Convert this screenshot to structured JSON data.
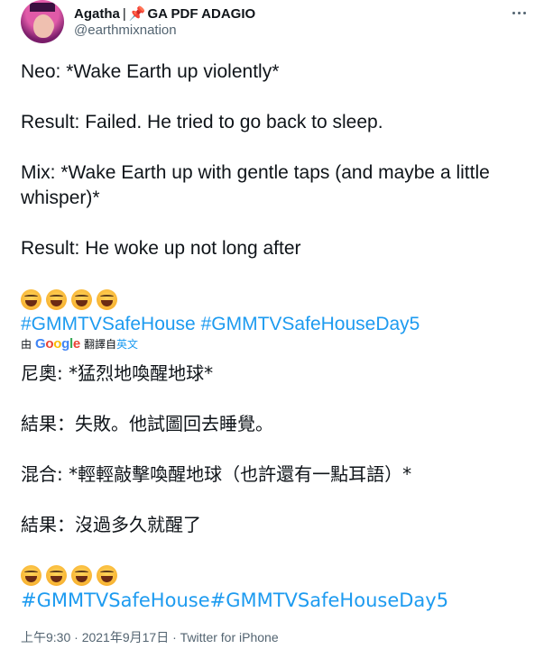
{
  "author": {
    "display_name": "Agatha",
    "separator": "|",
    "pin_emoji": "📌",
    "display_name_suffix": "GA PDF ADAGIO",
    "handle": "@earthmixnation"
  },
  "tweet": {
    "lines": [
      "Neo: *Wake Earth up violently*",
      "Result: Failed. He tried to go back to sleep.",
      "Mix: *Wake Earth up with gentle taps (and maybe a little whisper)*",
      "Result: He woke up not long after"
    ],
    "emoji_name": "grinning-squinting-face",
    "emoji_count": 4,
    "hashtags": [
      "#GMMTVSafeHouse",
      "#GMMTVSafeHouseDay5"
    ]
  },
  "translation": {
    "prefix": "由",
    "provider": "Google",
    "suffix": "翻譯自",
    "language": "英文",
    "lines": [
      "尼奧: *猛烈地喚醒地球*",
      "結果：失敗。他試圖回去睡覺。",
      "混合: *輕輕敲擊喚醒地球（也許還有一點耳語）*",
      "結果：沒過多久就醒了"
    ],
    "hashtags_text": "#GMMTVSafeHouse#GMMTVSafeHouseDay5"
  },
  "meta": {
    "time": "上午9:30",
    "dot": "·",
    "date": "2021年9月17日",
    "source": "Twitter for iPhone"
  },
  "colors": {
    "link": "#1d9bf0",
    "secondary_text": "#536471",
    "text": "#0f1419"
  }
}
